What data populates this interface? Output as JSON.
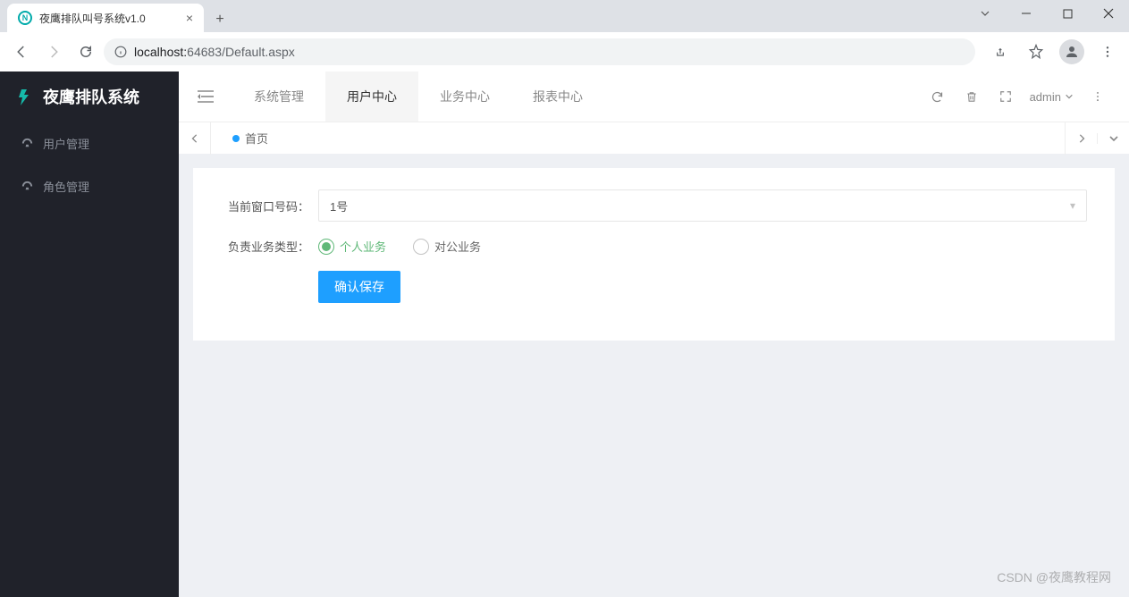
{
  "browser": {
    "tab_title": "夜鹰排队叫号系统v1.0",
    "url_host": "localhost:",
    "url_port": "64683",
    "url_path": "/Default.aspx"
  },
  "app": {
    "logo_text": "夜鹰排队系统",
    "sidebar": {
      "items": [
        {
          "label": "用户管理"
        },
        {
          "label": "角色管理"
        }
      ]
    },
    "topnav": {
      "items": [
        {
          "label": "系统管理",
          "active": false
        },
        {
          "label": "用户中心",
          "active": true
        },
        {
          "label": "业务中心",
          "active": false
        },
        {
          "label": "报表中心",
          "active": false
        }
      ]
    },
    "user": "admin",
    "page_tab": "首页",
    "form": {
      "window_label": "当前窗口号码：",
      "window_value": "1号",
      "biz_label": "负责业务类型：",
      "radio_options": [
        {
          "label": "个人业务",
          "checked": true
        },
        {
          "label": "对公业务",
          "checked": false
        }
      ],
      "submit_label": "确认保存"
    }
  },
  "watermark": "CSDN @夜鹰教程网"
}
